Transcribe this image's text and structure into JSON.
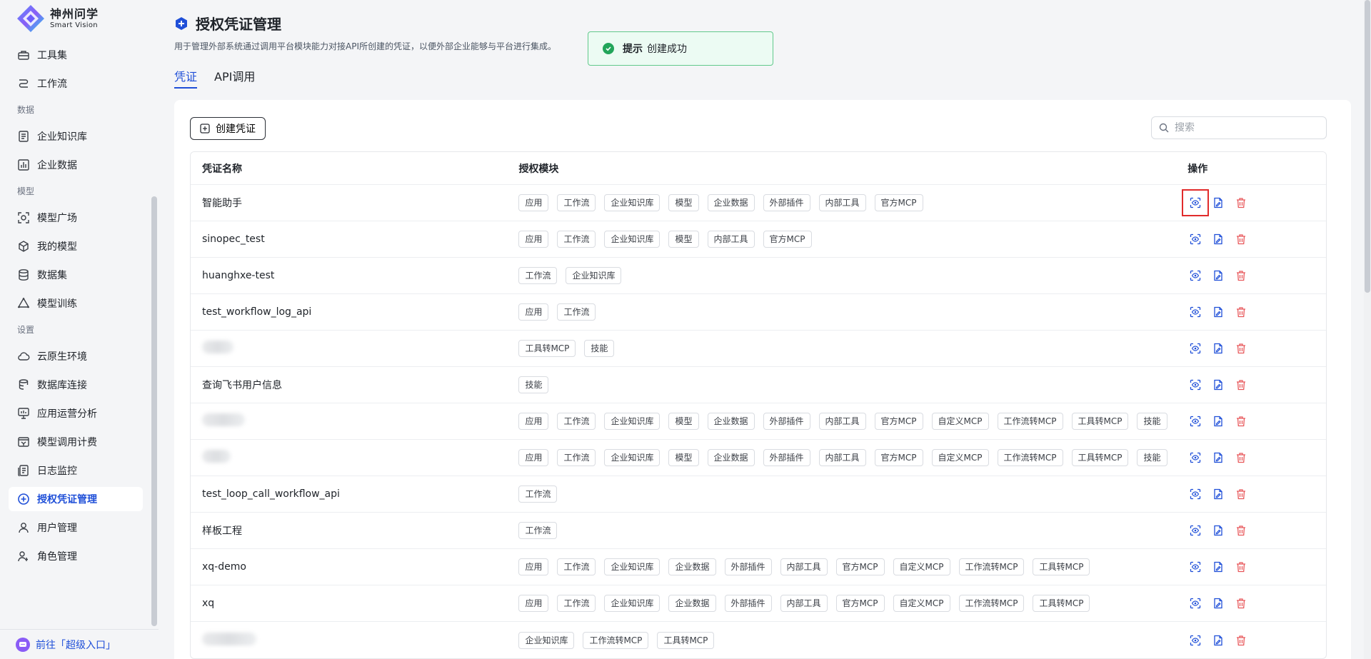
{
  "brand": {
    "name_cn": "神州问学",
    "name_en": "Smart Vision"
  },
  "sidebar": {
    "items": [
      {
        "type": "item",
        "label": "工具集",
        "icon": "toolbox-icon"
      },
      {
        "type": "item",
        "label": "工作流",
        "icon": "workflow-icon"
      },
      {
        "type": "section",
        "label": "数据"
      },
      {
        "type": "item",
        "label": "企业知识库",
        "icon": "knowledge-base-icon"
      },
      {
        "type": "item",
        "label": "企业数据",
        "icon": "bar-chart-icon"
      },
      {
        "type": "section",
        "label": "模型"
      },
      {
        "type": "item",
        "label": "模型广场",
        "icon": "model-square-icon"
      },
      {
        "type": "item",
        "label": "我的模型",
        "icon": "cube-icon"
      },
      {
        "type": "item",
        "label": "数据集",
        "icon": "database-icon"
      },
      {
        "type": "item",
        "label": "模型训练",
        "icon": "training-icon"
      },
      {
        "type": "section",
        "label": "设置"
      },
      {
        "type": "item",
        "label": "云原生环境",
        "icon": "cloud-icon"
      },
      {
        "type": "item",
        "label": "数据库连接",
        "icon": "db-connect-icon"
      },
      {
        "type": "item",
        "label": "应用运营分析",
        "icon": "monitor-icon"
      },
      {
        "type": "item",
        "label": "模型调用计费",
        "icon": "billing-icon"
      },
      {
        "type": "item",
        "label": "日志监控",
        "icon": "log-icon"
      },
      {
        "type": "item",
        "label": "授权凭证管理",
        "icon": "credential-icon",
        "active": true
      },
      {
        "type": "item",
        "label": "用户管理",
        "icon": "user-icon"
      },
      {
        "type": "item",
        "label": "角色管理",
        "icon": "role-icon"
      }
    ],
    "bottom_link": "前往「超级入口」"
  },
  "page": {
    "title": "授权凭证管理",
    "description": "用于管理外部系统通过调用平台模块能力对接API所创建的凭证，以便外部企业能够与平台进行集成。",
    "tabs": [
      {
        "label": "凭证",
        "active": true
      },
      {
        "label": "API调用",
        "active": false
      }
    ]
  },
  "toast": {
    "title": "提示",
    "message": "创建成功",
    "status_color": "#22a55a"
  },
  "toolbar": {
    "create_label": "创建凭证",
    "search_placeholder": "搜索"
  },
  "table": {
    "headers": {
      "name": "凭证名称",
      "modules": "授权模块",
      "actions": "操作"
    },
    "rows": [
      {
        "name": "智能助手",
        "blurred": false,
        "modules": [
          "应用",
          "工作流",
          "企业知识库",
          "模型",
          "企业数据",
          "外部插件",
          "内部工具",
          "官方MCP"
        ],
        "highlight": true
      },
      {
        "name": "sinopec_test",
        "blurred": false,
        "modules": [
          "应用",
          "工作流",
          "企业知识库",
          "模型",
          "内部工具",
          "官方MCP"
        ]
      },
      {
        "name": "huanghxe-test",
        "blurred": false,
        "modules": [
          "工作流",
          "企业知识库"
        ]
      },
      {
        "name": "test_workflow_log_api",
        "blurred": false,
        "modules": [
          "应用",
          "工作流"
        ]
      },
      {
        "name": "",
        "blurred": true,
        "modules": [
          "工具转MCP",
          "技能"
        ]
      },
      {
        "name": "查询飞书用户信息",
        "blurred": false,
        "modules": [
          "技能"
        ]
      },
      {
        "name": "",
        "blurred": true,
        "modules": [
          "应用",
          "工作流",
          "企业知识库",
          "模型",
          "企业数据",
          "外部插件",
          "内部工具",
          "官方MCP",
          "自定义MCP",
          "工作流转MCP",
          "工具转MCP",
          "技能"
        ]
      },
      {
        "name": "",
        "blurred": true,
        "modules": [
          "应用",
          "工作流",
          "企业知识库",
          "模型",
          "企业数据",
          "外部插件",
          "内部工具",
          "官方MCP",
          "自定义MCP",
          "工作流转MCP",
          "工具转MCP",
          "技能"
        ]
      },
      {
        "name": "test_loop_call_workflow_api",
        "blurred": false,
        "modules": [
          "工作流"
        ]
      },
      {
        "name": "样板工程",
        "blurred": false,
        "modules": [
          "工作流"
        ]
      },
      {
        "name": "xq-demo",
        "blurred": false,
        "modules": [
          "应用",
          "工作流",
          "企业知识库",
          "企业数据",
          "外部插件",
          "内部工具",
          "官方MCP",
          "自定义MCP",
          "工作流转MCP",
          "工具转MCP"
        ]
      },
      {
        "name": "xq",
        "blurred": false,
        "modules": [
          "应用",
          "工作流",
          "企业知识库",
          "企业数据",
          "外部插件",
          "内部工具",
          "官方MCP",
          "自定义MCP",
          "工作流转MCP",
          "工具转MCP"
        ]
      },
      {
        "name": "",
        "blurred": true,
        "modules": [
          "企业知识库",
          "工作流转MCP",
          "工具转MCP"
        ]
      }
    ],
    "action_icons": [
      "view-icon",
      "edit-document-icon",
      "delete-icon"
    ]
  },
  "colors": {
    "accent": "#1f4fd8",
    "danger": "#e8575a",
    "highlight_box": "#e12b2b"
  }
}
